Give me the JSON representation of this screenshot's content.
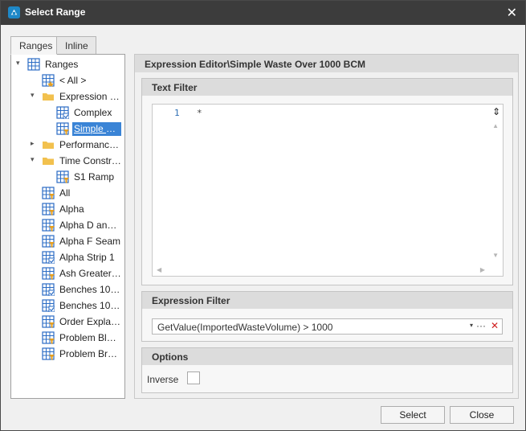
{
  "window": {
    "title": "Select Range",
    "close_glyph": "✕"
  },
  "tabs": [
    {
      "label": "Ranges",
      "active": true
    },
    {
      "label": "Inline",
      "active": false
    }
  ],
  "tree": [
    {
      "label": "Ranges",
      "icon": "grid-blue-icon",
      "expander": "collapse"
    },
    {
      "label": "< All >",
      "icon": "grid-star-icon"
    },
    {
      "label": "Expression E...",
      "icon": "folder-open-icon",
      "expander": "collapse"
    },
    {
      "label": "Complex",
      "icon": "grid-check-icon"
    },
    {
      "label": "Simple W...",
      "icon": "grid-filter-icon",
      "selected": true
    },
    {
      "label": "Performance ...",
      "icon": "folder-icon",
      "expander": "expand"
    },
    {
      "label": "Time Constraint",
      "icon": "folder-open-icon",
      "expander": "collapse"
    },
    {
      "label": "S1 Ramp",
      "icon": "grid-filter-icon"
    },
    {
      "label": "All",
      "icon": "grid-filter-icon"
    },
    {
      "label": "Alpha",
      "icon": "grid-filter-icon"
    },
    {
      "label": "Alpha D and ...",
      "icon": "grid-filter-icon"
    },
    {
      "label": "Alpha F Seam",
      "icon": "grid-filter-icon"
    },
    {
      "label": "Alpha Strip 1",
      "icon": "grid-check-icon"
    },
    {
      "label": "Ash Greater ...",
      "icon": "grid-filter-icon"
    },
    {
      "label": "Benches 100 ...",
      "icon": "grid-check-icon"
    },
    {
      "label": "Benches 100 ...",
      "icon": "grid-check-icon"
    },
    {
      "label": "Order Explan...",
      "icon": "grid-filter-icon"
    },
    {
      "label": "Problem Blocks",
      "icon": "grid-filter-icon"
    },
    {
      "label": "Problem Brav...",
      "icon": "grid-filter-icon"
    }
  ],
  "detail": {
    "header": "Expression Editor\\Simple Waste Over 1000 BCM",
    "text_filter": {
      "title": "Text Filter",
      "line_number": "1",
      "code": "*"
    },
    "expression_filter": {
      "title": "Expression Filter",
      "value": "GetValue(ImportedWasteVolume) > 1000",
      "dropdown_glyph": "▾",
      "more_glyph": "···",
      "clear_glyph": "✕"
    },
    "options": {
      "title": "Options",
      "inverse_label": "Inverse",
      "inverse_checked": false
    }
  },
  "buttons": {
    "select": "Select",
    "close": "Close"
  },
  "colors": {
    "titlebar": "#3c3c3c",
    "selection": "#3a84d6",
    "icon_blue": "#2b6cc4",
    "folder": "#f2c14e",
    "badge": "#e8a020"
  }
}
